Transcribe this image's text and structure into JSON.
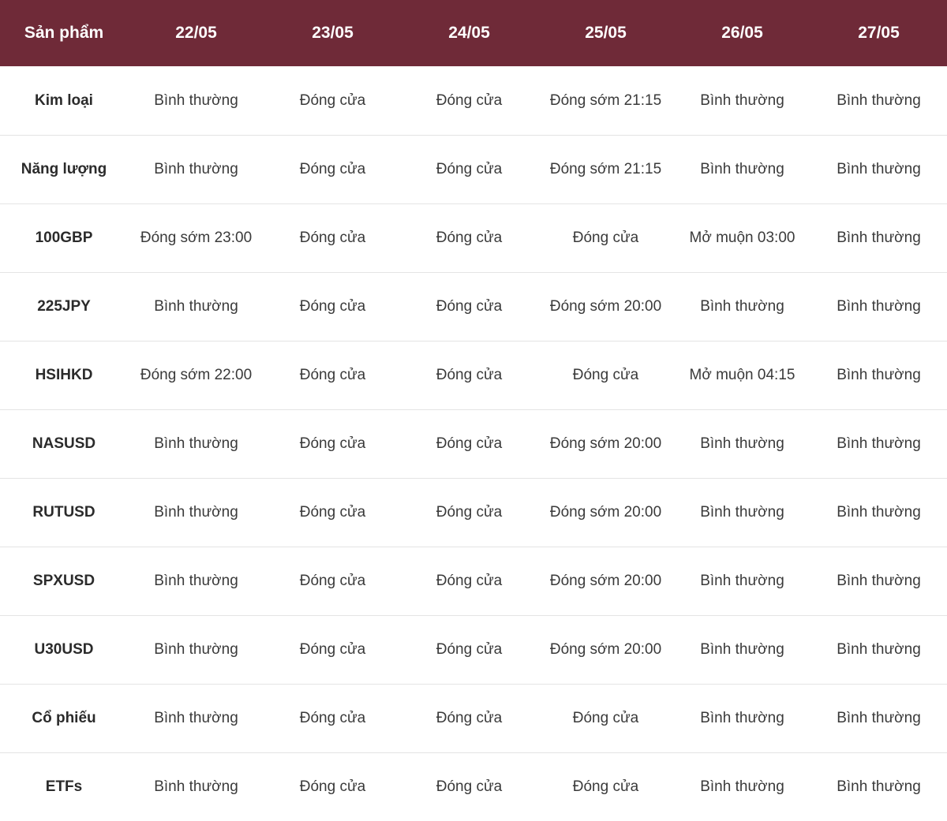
{
  "table": {
    "headers": [
      "Sản phẩm",
      "22/05",
      "23/05",
      "24/05",
      "25/05",
      "26/05",
      "27/05"
    ],
    "rows": [
      {
        "product": "Kim loại",
        "cells": [
          "Bình thường",
          "Đóng cửa",
          "Đóng cửa",
          "Đóng sớm 21:15",
          "Bình thường",
          "Bình thường"
        ]
      },
      {
        "product": "Năng lượng",
        "cells": [
          "Bình thường",
          "Đóng cửa",
          "Đóng cửa",
          "Đóng sớm 21:15",
          "Bình thường",
          "Bình thường"
        ]
      },
      {
        "product": "100GBP",
        "cells": [
          "Đóng sớm 23:00",
          "Đóng cửa",
          "Đóng cửa",
          "Đóng cửa",
          "Mở muộn 03:00",
          "Bình thường"
        ]
      },
      {
        "product": "225JPY",
        "cells": [
          "Bình thường",
          "Đóng cửa",
          "Đóng cửa",
          "Đóng sớm 20:00",
          "Bình thường",
          "Bình thường"
        ]
      },
      {
        "product": "HSIHKD",
        "cells": [
          "Đóng sớm 22:00",
          "Đóng cửa",
          "Đóng cửa",
          "Đóng cửa",
          "Mở muộn 04:15",
          "Bình thường"
        ]
      },
      {
        "product": "NASUSD",
        "cells": [
          "Bình thường",
          "Đóng cửa",
          "Đóng cửa",
          "Đóng sớm 20:00",
          "Bình thường",
          "Bình thường"
        ]
      },
      {
        "product": "RUTUSD",
        "cells": [
          "Bình thường",
          "Đóng cửa",
          "Đóng cửa",
          "Đóng sớm 20:00",
          "Bình thường",
          "Bình thường"
        ]
      },
      {
        "product": "SPXUSD",
        "cells": [
          "Bình thường",
          "Đóng cửa",
          "Đóng cửa",
          "Đóng sớm 20:00",
          "Bình thường",
          "Bình thường"
        ]
      },
      {
        "product": "U30USD",
        "cells": [
          "Bình thường",
          "Đóng cửa",
          "Đóng cửa",
          "Đóng sớm 20:00",
          "Bình thường",
          "Bình thường"
        ]
      },
      {
        "product": "Cổ phiếu",
        "cells": [
          "Bình thường",
          "Đóng cửa",
          "Đóng cửa",
          "Đóng cửa",
          "Bình thường",
          "Bình thường"
        ]
      },
      {
        "product": "ETFs",
        "cells": [
          "Bình thường",
          "Đóng cửa",
          "Đóng cửa",
          "Đóng cửa",
          "Bình thường",
          "Bình thường"
        ]
      }
    ]
  },
  "colors": {
    "header_background": "#6f2a38",
    "header_text": "#ffffff",
    "row_divider": "#e4e4e4"
  }
}
